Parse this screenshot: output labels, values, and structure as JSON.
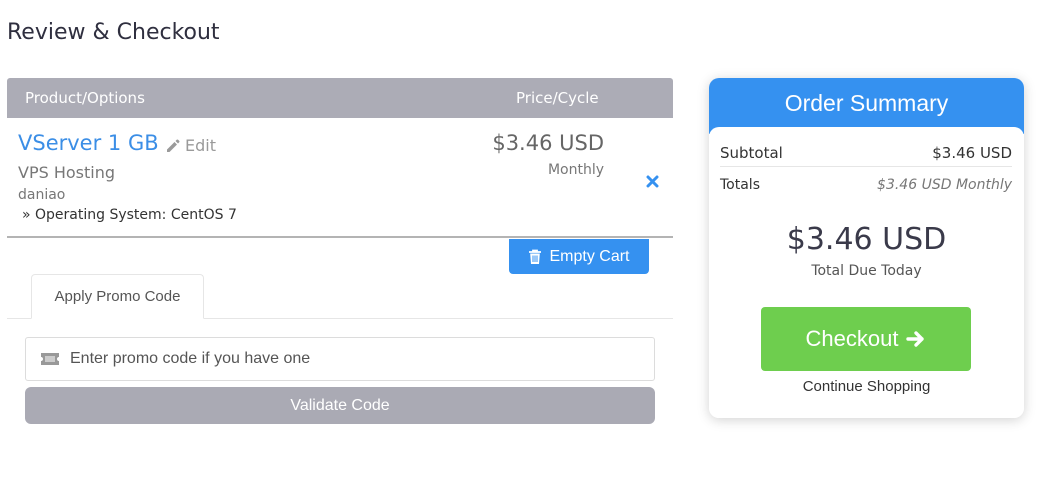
{
  "page": {
    "title": "Review & Checkout"
  },
  "cart": {
    "headers": {
      "product": "Product/Options",
      "price": "Price/Cycle"
    },
    "item": {
      "name": "VServer 1 GB",
      "edit_label": "Edit",
      "group": "VPS Hosting",
      "hostname": "daniao",
      "option": "» Operating System: CentOS 7",
      "price": "$3.46 USD",
      "cycle": "Monthly"
    },
    "empty_cart_label": "Empty Cart"
  },
  "promo": {
    "tab_label": "Apply Promo Code",
    "placeholder": "Enter promo code if you have one",
    "validate_label": "Validate Code"
  },
  "summary": {
    "title": "Order Summary",
    "subtotal_label": "Subtotal",
    "subtotal_value": "$3.46 USD",
    "totals_label": "Totals",
    "totals_value": "$3.46 USD Monthly",
    "total_due": "$3.46 USD",
    "total_due_label": "Total Due Today",
    "checkout_label": "Checkout",
    "continue_label": "Continue Shopping"
  },
  "colors": {
    "accent": "#3591f0",
    "success": "#6ece4e",
    "header_gray": "#acacb6",
    "link_blue": "#3b8ee6"
  },
  "icons": [
    "pencil-icon",
    "close-icon",
    "trash-icon",
    "ticket-icon",
    "arrow-right-icon"
  ]
}
